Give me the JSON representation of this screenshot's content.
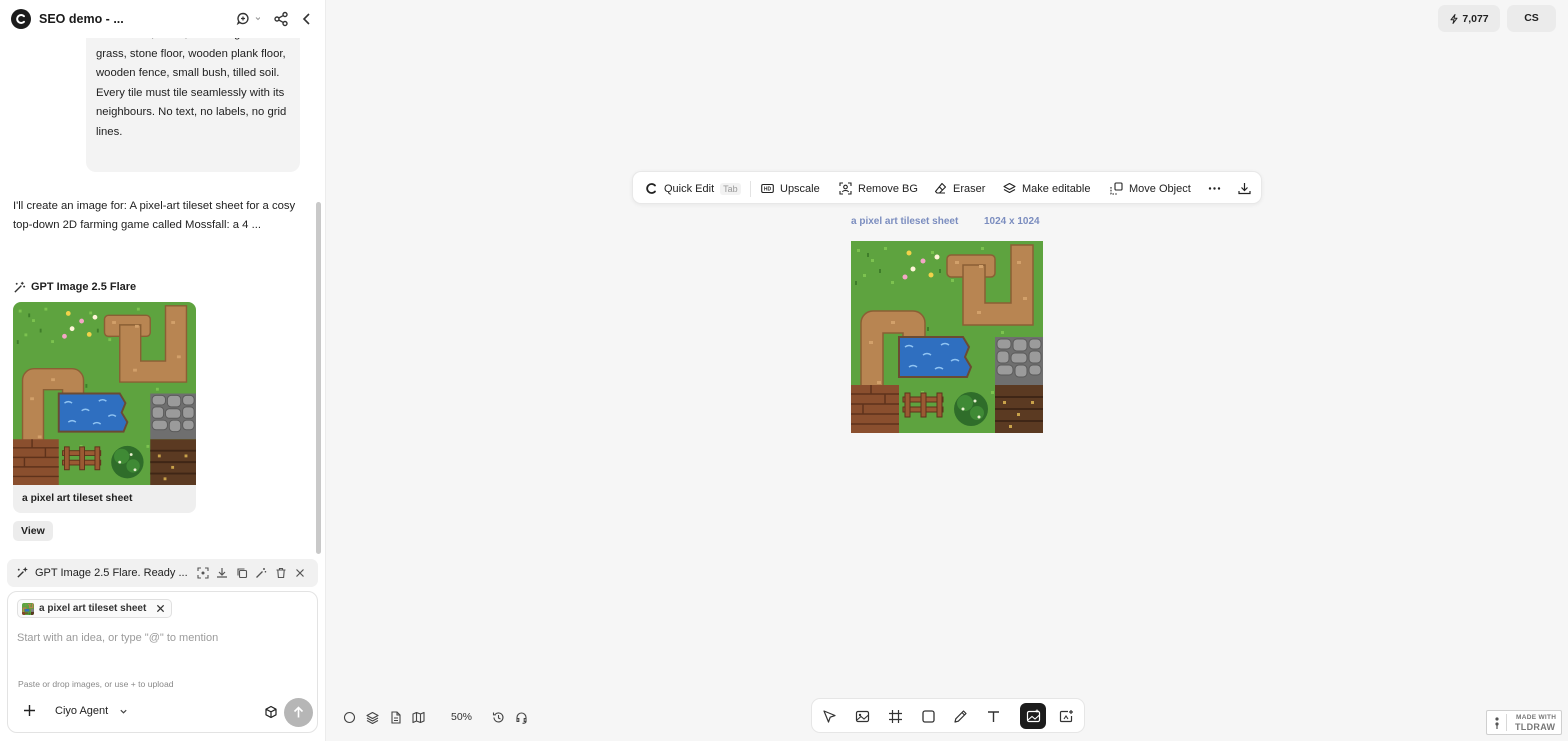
{
  "header": {
    "project_title": "SEO demo - ..."
  },
  "chat": {
    "user_message": "crossroads, water, water edge with grass, stone floor, wooden plank floor, wooden fence, small bush, tilled soil. Every tile must tile seamlessly with its neighbours. No text, no labels, no grid lines.",
    "assistant_message": "I'll create an image for: A pixel-art tileset sheet for a cosy top-down 2D farming game called Mossfall: a 4 ...",
    "model_name": "GPT Image 2.5 Flare",
    "result_caption": "a pixel art tileset sheet",
    "view_button": "View"
  },
  "status_bar": {
    "text": "GPT Image 2.5 Flare. Ready ..."
  },
  "composer": {
    "reference_chip": "a pixel art tileset sheet",
    "placeholder": "Start with an idea, or type \"@\" to mention",
    "upload_hint": "Paste or drop images, or use + to upload",
    "agent_name": "Ciyo Agent"
  },
  "topbar": {
    "credits": "7,077",
    "user_initials": "CS"
  },
  "image_toolbar": {
    "quick_edit": "Quick Edit",
    "quick_edit_shortcut": "Tab",
    "upscale": "Upscale",
    "remove_bg": "Remove BG",
    "eraser": "Eraser",
    "make_editable": "Make editable",
    "move_object": "Move Object"
  },
  "canvas_image": {
    "name": "a pixel art tileset sheet",
    "dimensions": "1024 x 1024"
  },
  "bottom_controls": {
    "zoom": "50%"
  },
  "tools": [
    "select",
    "image-generate",
    "frame",
    "rectangle",
    "pencil",
    "text",
    "image-edit",
    "image-add"
  ],
  "active_tool": "image-edit",
  "badge": {
    "line1": "MADE WITH",
    "line2": "TLDRAW"
  },
  "colors": {
    "grass": "#5ea33f",
    "dirt": "#b88552",
    "water": "#2f6fc0",
    "stone": "#8a8a8a",
    "plank": "#8a4f2e",
    "soil": "#5b3a22",
    "accent_label": "#7b8dbf"
  }
}
